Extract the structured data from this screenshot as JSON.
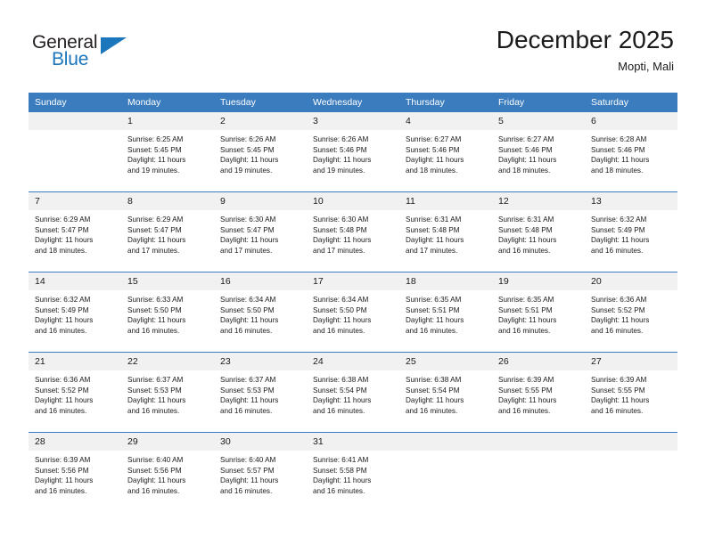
{
  "brand": {
    "name_top": "General",
    "name_bottom": "Blue",
    "accent_color": "#1b76bc",
    "flag_icon": "brand-flag-triangle"
  },
  "header": {
    "title": "December 2025",
    "subtitle": "Mopti, Mali"
  },
  "calendar": {
    "header_bg": "#3a7cbe",
    "header_text_color": "#ffffff",
    "daynum_bg": "#f1f1f1",
    "weekdays": [
      "Sunday",
      "Monday",
      "Tuesday",
      "Wednesday",
      "Thursday",
      "Friday",
      "Saturday"
    ],
    "weeks": [
      [
        {
          "day": "",
          "blank": true,
          "sunrise": "",
          "sunset": "",
          "daylight_line1": "",
          "daylight_line2": ""
        },
        {
          "day": "1",
          "blank": false,
          "sunrise": "Sunrise: 6:25 AM",
          "sunset": "Sunset: 5:45 PM",
          "daylight_line1": "Daylight: 11 hours",
          "daylight_line2": "and 19 minutes."
        },
        {
          "day": "2",
          "blank": false,
          "sunrise": "Sunrise: 6:26 AM",
          "sunset": "Sunset: 5:45 PM",
          "daylight_line1": "Daylight: 11 hours",
          "daylight_line2": "and 19 minutes."
        },
        {
          "day": "3",
          "blank": false,
          "sunrise": "Sunrise: 6:26 AM",
          "sunset": "Sunset: 5:46 PM",
          "daylight_line1": "Daylight: 11 hours",
          "daylight_line2": "and 19 minutes."
        },
        {
          "day": "4",
          "blank": false,
          "sunrise": "Sunrise: 6:27 AM",
          "sunset": "Sunset: 5:46 PM",
          "daylight_line1": "Daylight: 11 hours",
          "daylight_line2": "and 18 minutes."
        },
        {
          "day": "5",
          "blank": false,
          "sunrise": "Sunrise: 6:27 AM",
          "sunset": "Sunset: 5:46 PM",
          "daylight_line1": "Daylight: 11 hours",
          "daylight_line2": "and 18 minutes."
        },
        {
          "day": "6",
          "blank": false,
          "sunrise": "Sunrise: 6:28 AM",
          "sunset": "Sunset: 5:46 PM",
          "daylight_line1": "Daylight: 11 hours",
          "daylight_line2": "and 18 minutes."
        }
      ],
      [
        {
          "day": "7",
          "blank": false,
          "sunrise": "Sunrise: 6:29 AM",
          "sunset": "Sunset: 5:47 PM",
          "daylight_line1": "Daylight: 11 hours",
          "daylight_line2": "and 18 minutes."
        },
        {
          "day": "8",
          "blank": false,
          "sunrise": "Sunrise: 6:29 AM",
          "sunset": "Sunset: 5:47 PM",
          "daylight_line1": "Daylight: 11 hours",
          "daylight_line2": "and 17 minutes."
        },
        {
          "day": "9",
          "blank": false,
          "sunrise": "Sunrise: 6:30 AM",
          "sunset": "Sunset: 5:47 PM",
          "daylight_line1": "Daylight: 11 hours",
          "daylight_line2": "and 17 minutes."
        },
        {
          "day": "10",
          "blank": false,
          "sunrise": "Sunrise: 6:30 AM",
          "sunset": "Sunset: 5:48 PM",
          "daylight_line1": "Daylight: 11 hours",
          "daylight_line2": "and 17 minutes."
        },
        {
          "day": "11",
          "blank": false,
          "sunrise": "Sunrise: 6:31 AM",
          "sunset": "Sunset: 5:48 PM",
          "daylight_line1": "Daylight: 11 hours",
          "daylight_line2": "and 17 minutes."
        },
        {
          "day": "12",
          "blank": false,
          "sunrise": "Sunrise: 6:31 AM",
          "sunset": "Sunset: 5:48 PM",
          "daylight_line1": "Daylight: 11 hours",
          "daylight_line2": "and 16 minutes."
        },
        {
          "day": "13",
          "blank": false,
          "sunrise": "Sunrise: 6:32 AM",
          "sunset": "Sunset: 5:49 PM",
          "daylight_line1": "Daylight: 11 hours",
          "daylight_line2": "and 16 minutes."
        }
      ],
      [
        {
          "day": "14",
          "blank": false,
          "sunrise": "Sunrise: 6:32 AM",
          "sunset": "Sunset: 5:49 PM",
          "daylight_line1": "Daylight: 11 hours",
          "daylight_line2": "and 16 minutes."
        },
        {
          "day": "15",
          "blank": false,
          "sunrise": "Sunrise: 6:33 AM",
          "sunset": "Sunset: 5:50 PM",
          "daylight_line1": "Daylight: 11 hours",
          "daylight_line2": "and 16 minutes."
        },
        {
          "day": "16",
          "blank": false,
          "sunrise": "Sunrise: 6:34 AM",
          "sunset": "Sunset: 5:50 PM",
          "daylight_line1": "Daylight: 11 hours",
          "daylight_line2": "and 16 minutes."
        },
        {
          "day": "17",
          "blank": false,
          "sunrise": "Sunrise: 6:34 AM",
          "sunset": "Sunset: 5:50 PM",
          "daylight_line1": "Daylight: 11 hours",
          "daylight_line2": "and 16 minutes."
        },
        {
          "day": "18",
          "blank": false,
          "sunrise": "Sunrise: 6:35 AM",
          "sunset": "Sunset: 5:51 PM",
          "daylight_line1": "Daylight: 11 hours",
          "daylight_line2": "and 16 minutes."
        },
        {
          "day": "19",
          "blank": false,
          "sunrise": "Sunrise: 6:35 AM",
          "sunset": "Sunset: 5:51 PM",
          "daylight_line1": "Daylight: 11 hours",
          "daylight_line2": "and 16 minutes."
        },
        {
          "day": "20",
          "blank": false,
          "sunrise": "Sunrise: 6:36 AM",
          "sunset": "Sunset: 5:52 PM",
          "daylight_line1": "Daylight: 11 hours",
          "daylight_line2": "and 16 minutes."
        }
      ],
      [
        {
          "day": "21",
          "blank": false,
          "sunrise": "Sunrise: 6:36 AM",
          "sunset": "Sunset: 5:52 PM",
          "daylight_line1": "Daylight: 11 hours",
          "daylight_line2": "and 16 minutes."
        },
        {
          "day": "22",
          "blank": false,
          "sunrise": "Sunrise: 6:37 AM",
          "sunset": "Sunset: 5:53 PM",
          "daylight_line1": "Daylight: 11 hours",
          "daylight_line2": "and 16 minutes."
        },
        {
          "day": "23",
          "blank": false,
          "sunrise": "Sunrise: 6:37 AM",
          "sunset": "Sunset: 5:53 PM",
          "daylight_line1": "Daylight: 11 hours",
          "daylight_line2": "and 16 minutes."
        },
        {
          "day": "24",
          "blank": false,
          "sunrise": "Sunrise: 6:38 AM",
          "sunset": "Sunset: 5:54 PM",
          "daylight_line1": "Daylight: 11 hours",
          "daylight_line2": "and 16 minutes."
        },
        {
          "day": "25",
          "blank": false,
          "sunrise": "Sunrise: 6:38 AM",
          "sunset": "Sunset: 5:54 PM",
          "daylight_line1": "Daylight: 11 hours",
          "daylight_line2": "and 16 minutes."
        },
        {
          "day": "26",
          "blank": false,
          "sunrise": "Sunrise: 6:39 AM",
          "sunset": "Sunset: 5:55 PM",
          "daylight_line1": "Daylight: 11 hours",
          "daylight_line2": "and 16 minutes."
        },
        {
          "day": "27",
          "blank": false,
          "sunrise": "Sunrise: 6:39 AM",
          "sunset": "Sunset: 5:55 PM",
          "daylight_line1": "Daylight: 11 hours",
          "daylight_line2": "and 16 minutes."
        }
      ],
      [
        {
          "day": "28",
          "blank": false,
          "sunrise": "Sunrise: 6:39 AM",
          "sunset": "Sunset: 5:56 PM",
          "daylight_line1": "Daylight: 11 hours",
          "daylight_line2": "and 16 minutes."
        },
        {
          "day": "29",
          "blank": false,
          "sunrise": "Sunrise: 6:40 AM",
          "sunset": "Sunset: 5:56 PM",
          "daylight_line1": "Daylight: 11 hours",
          "daylight_line2": "and 16 minutes."
        },
        {
          "day": "30",
          "blank": false,
          "sunrise": "Sunrise: 6:40 AM",
          "sunset": "Sunset: 5:57 PM",
          "daylight_line1": "Daylight: 11 hours",
          "daylight_line2": "and 16 minutes."
        },
        {
          "day": "31",
          "blank": false,
          "sunrise": "Sunrise: 6:41 AM",
          "sunset": "Sunset: 5:58 PM",
          "daylight_line1": "Daylight: 11 hours",
          "daylight_line2": "and 16 minutes."
        },
        {
          "day": "",
          "blank": true,
          "sunrise": "",
          "sunset": "",
          "daylight_line1": "",
          "daylight_line2": ""
        },
        {
          "day": "",
          "blank": true,
          "sunrise": "",
          "sunset": "",
          "daylight_line1": "",
          "daylight_line2": ""
        },
        {
          "day": "",
          "blank": true,
          "sunrise": "",
          "sunset": "",
          "daylight_line1": "",
          "daylight_line2": ""
        }
      ]
    ]
  }
}
